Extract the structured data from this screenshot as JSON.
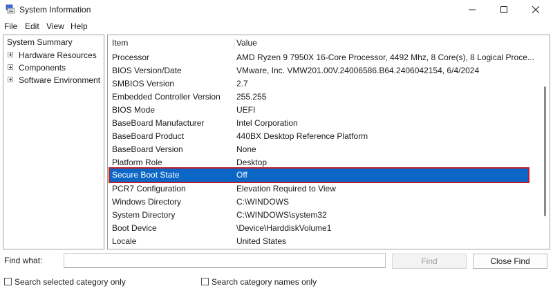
{
  "window": {
    "title": "System Information"
  },
  "menu": [
    "File",
    "Edit",
    "View",
    "Help"
  ],
  "tree": {
    "root": "System Summary",
    "children": [
      "Hardware Resources",
      "Components",
      "Software Environment"
    ]
  },
  "table": {
    "headers": [
      "Item",
      "Value"
    ],
    "rows": [
      [
        "Processor",
        "AMD Ryzen 9 7950X 16-Core Processor, 4492 Mhz, 8 Core(s), 8 Logical Proce..."
      ],
      [
        "BIOS Version/Date",
        "VMware, Inc. VMW201.00V.24006586.B64.2406042154, 6/4/2024"
      ],
      [
        "SMBIOS Version",
        "2.7"
      ],
      [
        "Embedded Controller Version",
        "255.255"
      ],
      [
        "BIOS Mode",
        "UEFI"
      ],
      [
        "BaseBoard Manufacturer",
        "Intel Corporation"
      ],
      [
        "BaseBoard Product",
        "440BX Desktop Reference Platform"
      ],
      [
        "BaseBoard Version",
        "None"
      ],
      [
        "Platform Role",
        "Desktop"
      ],
      [
        "Secure Boot State",
        "Off"
      ],
      [
        "PCR7 Configuration",
        "Elevation Required to View"
      ],
      [
        "Windows Directory",
        "C:\\WINDOWS"
      ],
      [
        "System Directory",
        "C:\\WINDOWS\\system32"
      ],
      [
        "Boot Device",
        "\\Device\\HarddiskVolume1"
      ],
      [
        "Locale",
        "United States"
      ]
    ],
    "selected_row": "Secure Boot State"
  },
  "find": {
    "label": "Find what:",
    "value": "",
    "find_button": "Find",
    "close_button": "Close Find",
    "search_selected_label": "Search selected category only",
    "search_names_label": "Search category names only"
  },
  "colors": {
    "selection": "#0b66c6",
    "highlight_outline": "#b8202e"
  }
}
